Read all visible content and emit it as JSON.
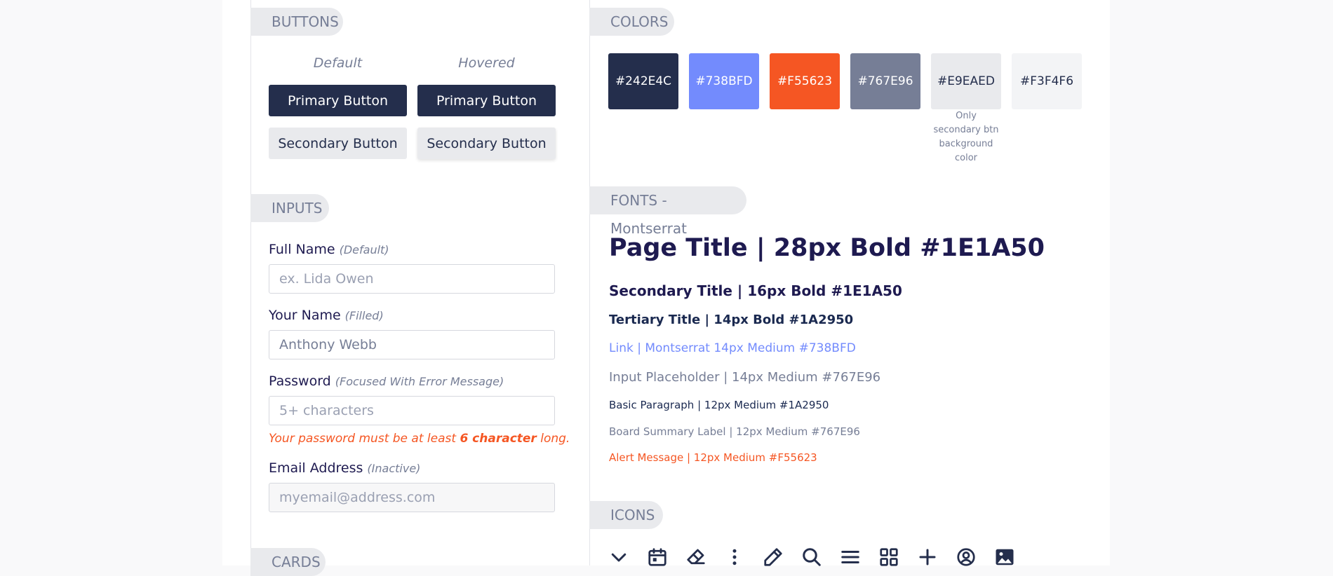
{
  "buttons": {
    "section_title": "BUTTONS",
    "default_label": "Default",
    "hovered_label": "Hovered",
    "primary_label": "Primary Button",
    "secondary_label": "Secondary Button"
  },
  "inputs": {
    "section_title": "INPUTS",
    "full_name": {
      "label": "Full Name",
      "hint": "(Default)",
      "placeholder": "ex. Lida Owen",
      "value": ""
    },
    "your_name": {
      "label": "Your Name",
      "hint": "(Filled)",
      "placeholder": "",
      "value": "Anthony Webb"
    },
    "password": {
      "label": "Password",
      "hint": "(Focused With Error Message)",
      "placeholder": "5+ characters",
      "value": "",
      "error_prefix": "Your password must be at least ",
      "error_bold": "6 character",
      "error_suffix": " long."
    },
    "email": {
      "label": "Email Address",
      "hint": "(Inactive)",
      "placeholder": "myemail@address.com",
      "value": ""
    }
  },
  "cards": {
    "section_title": "CARDS"
  },
  "colors": {
    "section_title": "COLORS",
    "swatches": [
      {
        "hex": "#242E4C",
        "bg": "#242e4c",
        "fg": "#ffffff"
      },
      {
        "hex": "#738BFD",
        "bg": "#738bfd",
        "fg": "#ffffff"
      },
      {
        "hex": "#F55623",
        "bg": "#f55623",
        "fg": "#ffffff"
      },
      {
        "hex": "#767E96",
        "bg": "#767e96",
        "fg": "#ffffff"
      },
      {
        "hex": "#E9EAED",
        "bg": "#e9eaed",
        "fg": "#242e4c"
      },
      {
        "hex": "#F3F4F6",
        "bg": "#f3f4f6",
        "fg": "#242e4c"
      }
    ],
    "note": "Only secondary btn background color"
  },
  "fonts": {
    "section_title": "FONTS - Montserrat",
    "page_title": "Page Title | 28px Bold #1E1A50",
    "secondary_title": "Secondary Title | 16px Bold #1E1A50",
    "tertiary_title": "Tertiary Title | 14px Bold #1A2950",
    "link": "Link | Montserrat 14px Medium #738BFD",
    "input_placeholder": "Input Placeholder | 14px Medium #767E96",
    "basic_paragraph": "Basic Paragraph | 12px Medium #1A2950",
    "board_summary": "Board Summary Label | 12px Medium #767E96",
    "alert_message": "Alert Message | 12px Medium #F55623"
  },
  "icons": {
    "section_title": "ICONS",
    "items": [
      "chevron-down-icon",
      "calendar-icon",
      "eraser-icon",
      "kebab-menu-icon",
      "pencil-icon",
      "search-icon",
      "hamburger-menu-icon",
      "grid-icon",
      "plus-icon",
      "user-circle-icon",
      "image-icon"
    ],
    "color": "#242e4c"
  }
}
